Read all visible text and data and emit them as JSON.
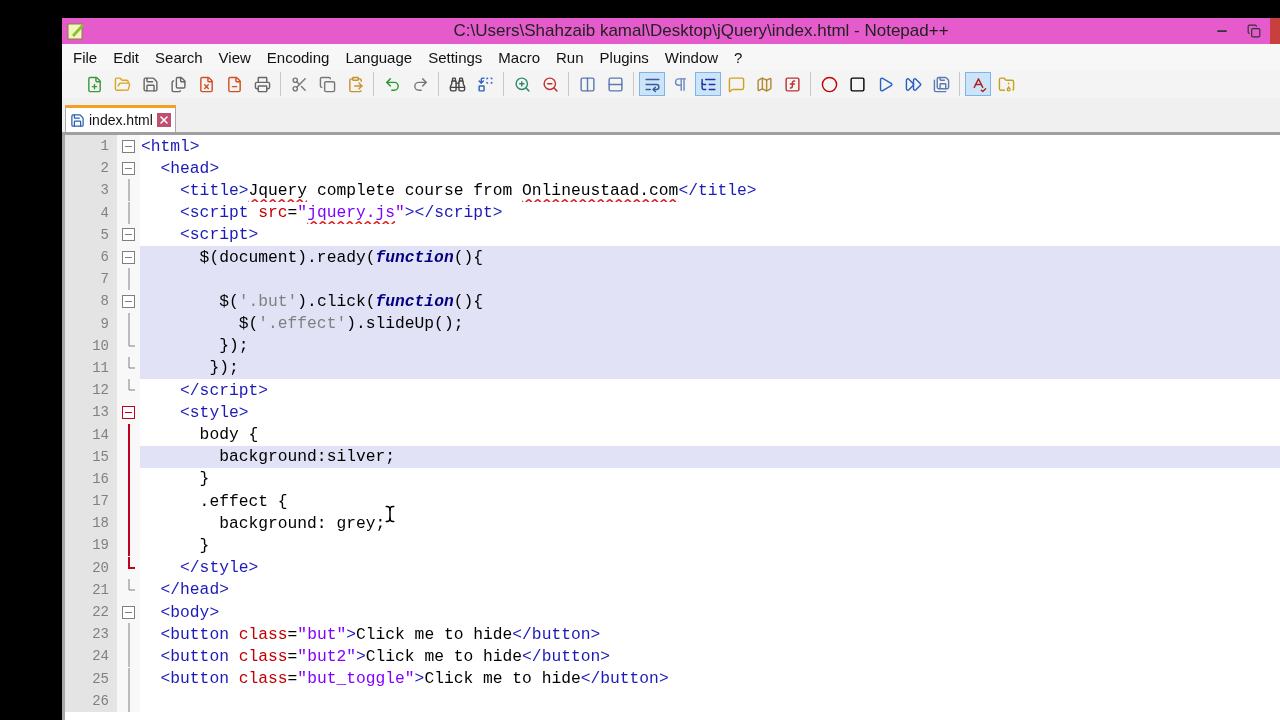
{
  "window": {
    "title": "C:\\Users\\Shahzaib kamal\\Desktop\\jQuery\\index.html - Notepad++"
  },
  "menu": [
    "File",
    "Edit",
    "Search",
    "View",
    "Encoding",
    "Language",
    "Settings",
    "Macro",
    "Run",
    "Plugins",
    "Window",
    "?"
  ],
  "toolbar": [
    [
      {
        "selected": false
      },
      {
        "selected": false
      },
      {
        "selected": false
      },
      {
        "selected": false
      },
      {
        "selected": false
      },
      {
        "selected": false
      },
      {
        "selected": false
      }
    ],
    [
      {
        "selected": false
      },
      {
        "selected": false
      },
      {
        "selected": false
      }
    ],
    [
      {
        "selected": false
      },
      {
        "selected": false
      }
    ],
    [
      {
        "selected": false
      },
      {
        "selected": false
      }
    ],
    [
      {
        "selected": false
      },
      {
        "selected": false
      }
    ],
    [
      {
        "selected": false
      },
      {
        "selected": false
      }
    ],
    [
      {
        "selected": true
      },
      {
        "selected": false
      },
      {
        "selected": true
      },
      {
        "selected": false
      },
      {
        "selected": false
      },
      {
        "selected": false
      }
    ],
    [
      {
        "selected": false
      },
      {
        "selected": false
      },
      {
        "selected": false
      },
      {
        "selected": false
      },
      {
        "selected": false
      }
    ],
    [
      {
        "selected": true
      },
      {
        "selected": false
      }
    ]
  ],
  "tabs": [
    {
      "label": "index.html",
      "selected": true
    }
  ],
  "editor": {
    "lines": [
      {
        "number": "1",
        "kind": "fold-box",
        "active": false,
        "shaded": false,
        "tokens": [
          {
            "kind": "tag",
            "text": "<html>"
          }
        ]
      },
      {
        "number": "2",
        "kind": "fold-box",
        "active": false,
        "shaded": false,
        "tokens": [
          {
            "kind": "tag",
            "text": "  <head>"
          }
        ]
      },
      {
        "number": "3",
        "kind": "fold-line",
        "active": false,
        "shaded": false,
        "tokens": [
          {
            "kind": "tag",
            "text": "    <title>"
          },
          {
            "kind": "text",
            "text": "Jquery",
            "misspelled": true
          },
          {
            "kind": "text",
            "text": " complete course from "
          },
          {
            "kind": "text",
            "text": "Onlineustaad.com",
            "misspelled": true
          },
          {
            "kind": "tag",
            "text": "</title>"
          }
        ]
      },
      {
        "number": "4",
        "kind": "fold-line",
        "active": false,
        "shaded": false,
        "tokens": [
          {
            "kind": "tag",
            "text": "    <script "
          },
          {
            "kind": "attr",
            "text": "src"
          },
          {
            "kind": "plain",
            "text": "="
          },
          {
            "kind": "string",
            "text": "\""
          },
          {
            "kind": "string",
            "text": "jquery.js",
            "misspelled": true
          },
          {
            "kind": "string",
            "text": "\""
          },
          {
            "kind": "tag",
            "text": "></script>"
          }
        ]
      },
      {
        "number": "5",
        "kind": "fold-box",
        "active": false,
        "shaded": false,
        "tokens": [
          {
            "kind": "tag",
            "text": "    <script>"
          }
        ]
      },
      {
        "number": "6",
        "kind": "fold-box",
        "active": false,
        "shaded": true,
        "tokens": [
          {
            "kind": "plain",
            "text": "      $(document).ready("
          },
          {
            "kind": "keyword",
            "text": "function"
          },
          {
            "kind": "plain",
            "text": "(){"
          }
        ]
      },
      {
        "number": "7",
        "kind": "fold-line",
        "active": false,
        "shaded": true
      },
      {
        "number": "8",
        "kind": "fold-box",
        "active": false,
        "shaded": true,
        "tokens": [
          {
            "kind": "plain",
            "text": "        $("
          },
          {
            "kind": "jsstring",
            "text": "'.but'"
          },
          {
            "kind": "plain",
            "text": ").click("
          },
          {
            "kind": "keyword",
            "text": "function"
          },
          {
            "kind": "plain",
            "text": "(){"
          }
        ]
      },
      {
        "number": "9",
        "kind": "fold-line",
        "active": false,
        "shaded": true,
        "tokens": [
          {
            "kind": "plain",
            "text": "          $("
          },
          {
            "kind": "jsstring",
            "text": "'.effect'"
          },
          {
            "kind": "plain",
            "text": ").slideUp();"
          }
        ]
      },
      {
        "number": "10",
        "kind": "fold-end",
        "active": false,
        "shaded": true,
        "tokens": [
          {
            "kind": "plain",
            "text": "        });"
          }
        ]
      },
      {
        "number": "11",
        "kind": "fold-end",
        "active": false,
        "shaded": true,
        "tokens": [
          {
            "kind": "plain",
            "text": "       });"
          }
        ]
      },
      {
        "number": "12",
        "kind": "fold-end",
        "active": false,
        "shaded": false,
        "tokens": [
          {
            "kind": "tag",
            "text": "    </script>"
          }
        ]
      },
      {
        "number": "13",
        "kind": "fold-box",
        "active": true,
        "shaded": false,
        "tokens": [
          {
            "kind": "tag",
            "text": "    <style>"
          }
        ]
      },
      {
        "number": "14",
        "kind": "fold-line",
        "active": true,
        "shaded": false,
        "tokens": [
          {
            "kind": "plain",
            "text": "      body {"
          }
        ]
      },
      {
        "number": "15",
        "kind": "fold-line",
        "active": true,
        "shaded": true,
        "tokens": [
          {
            "kind": "plain",
            "text": "        background:silver;"
          }
        ]
      },
      {
        "number": "16",
        "kind": "fold-line",
        "active": true,
        "shaded": false,
        "tokens": [
          {
            "kind": "plain",
            "text": "      }"
          }
        ]
      },
      {
        "number": "17",
        "kind": "fold-line",
        "active": true,
        "shaded": false,
        "tokens": [
          {
            "kind": "plain",
            "text": "      .effect {"
          }
        ]
      },
      {
        "number": "18",
        "kind": "fold-line",
        "active": true,
        "shaded": false,
        "tokens": [
          {
            "kind": "plain",
            "text": "        background: grey;"
          }
        ]
      },
      {
        "number": "19",
        "kind": "fold-line",
        "active": true,
        "shaded": false,
        "tokens": [
          {
            "kind": "plain",
            "text": "      }"
          }
        ]
      },
      {
        "number": "20",
        "kind": "fold-end",
        "active": true,
        "shaded": false,
        "tokens": [
          {
            "kind": "tag",
            "text": "    </style>"
          }
        ]
      },
      {
        "number": "21",
        "kind": "fold-end",
        "active": false,
        "shaded": false,
        "tokens": [
          {
            "kind": "tag",
            "text": "  </head>"
          }
        ]
      },
      {
        "number": "22",
        "kind": "fold-box",
        "active": false,
        "shaded": false,
        "tokens": [
          {
            "kind": "tag",
            "text": "  <body>"
          }
        ]
      },
      {
        "number": "23",
        "kind": "fold-line",
        "active": false,
        "shaded": false,
        "tokens": [
          {
            "kind": "tag",
            "text": "  <button "
          },
          {
            "kind": "attr",
            "text": "class"
          },
          {
            "kind": "plain",
            "text": "="
          },
          {
            "kind": "string",
            "text": "\"but\""
          },
          {
            "kind": "tag",
            "text": ">"
          },
          {
            "kind": "text",
            "text": "Click me to hide"
          },
          {
            "kind": "tag",
            "text": "</button>"
          }
        ]
      },
      {
        "number": "24",
        "kind": "fold-line",
        "active": false,
        "shaded": false,
        "tokens": [
          {
            "kind": "tag",
            "text": "  <button "
          },
          {
            "kind": "attr",
            "text": "class"
          },
          {
            "kind": "plain",
            "text": "="
          },
          {
            "kind": "string",
            "text": "\"but2\""
          },
          {
            "kind": "tag",
            "text": ">"
          },
          {
            "kind": "text",
            "text": "Click me to hide"
          },
          {
            "kind": "tag",
            "text": "</button>"
          }
        ]
      },
      {
        "number": "25",
        "kind": "fold-line",
        "active": false,
        "shaded": false,
        "tokens": [
          {
            "kind": "tag",
            "text": "  <button "
          },
          {
            "kind": "attr",
            "text": "class"
          },
          {
            "kind": "plain",
            "text": "="
          },
          {
            "kind": "string",
            "text": "\"but_toggle\""
          },
          {
            "kind": "tag",
            "text": ">"
          },
          {
            "kind": "text",
            "text": "Click me to hide"
          },
          {
            "kind": "tag",
            "text": "</button>"
          }
        ]
      },
      {
        "number": "26",
        "kind": "fold-line",
        "active": false,
        "shaded": false
      }
    ]
  }
}
